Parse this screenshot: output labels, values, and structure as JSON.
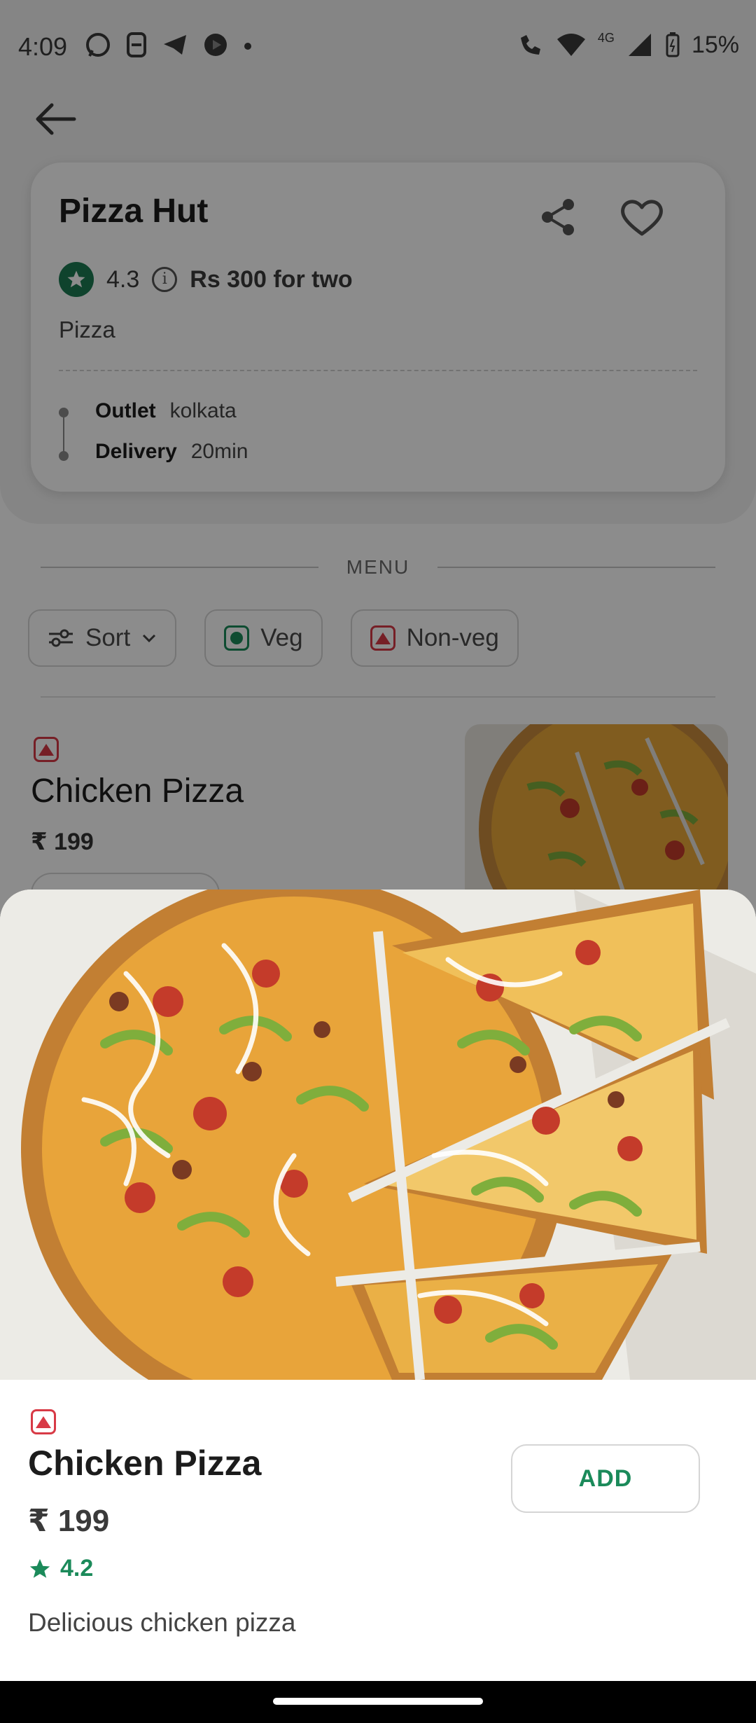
{
  "status_bar": {
    "time": "4:09",
    "battery": "15%",
    "network": "4G",
    "icons_left": [
      "whatsapp-icon",
      "notification-icon",
      "telegram-icon",
      "youtube-icon",
      "dot-icon"
    ],
    "icons_right": [
      "wifi-call-icon",
      "wifi-icon",
      "signal-icon",
      "battery-icon"
    ]
  },
  "restaurant": {
    "name": "Pizza Hut",
    "rating": "4.3",
    "price_for_two": "Rs 300 for two",
    "cuisine": "Pizza",
    "outlet_label": "Outlet",
    "outlet_value": "kolkata",
    "delivery_label": "Delivery",
    "delivery_value": "20min"
  },
  "menu": {
    "label": "MENU",
    "filters": {
      "sort": "Sort",
      "veg": "Veg",
      "nonveg": "Non-veg"
    },
    "background_item": {
      "name": "Chicken Pizza",
      "price": "₹ 199"
    }
  },
  "sheet": {
    "name": "Chicken Pizza",
    "price": "₹ 199",
    "rating": "4.2",
    "description": "Delicious chicken pizza",
    "add_label": "ADD"
  },
  "colors": {
    "veg_green": "#1b8a5a",
    "nonveg_red": "#d83a46",
    "rating_green": "#1c7a52"
  }
}
